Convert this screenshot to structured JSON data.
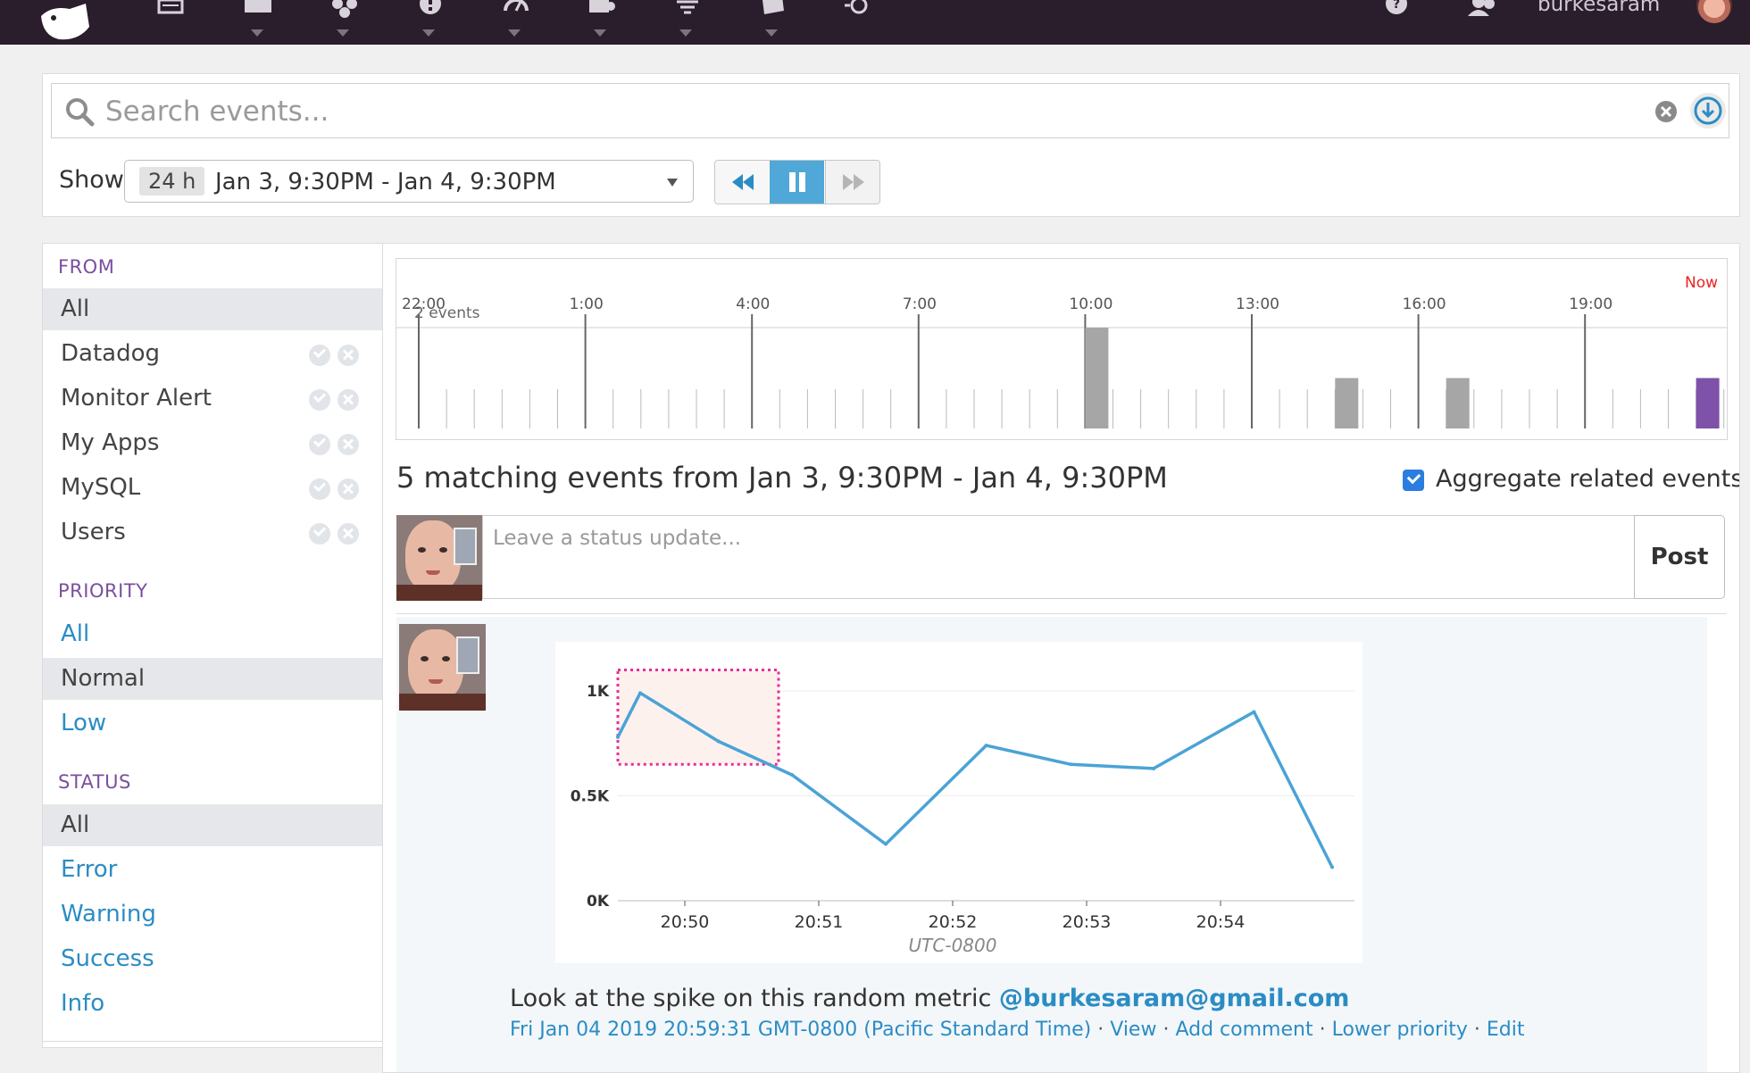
{
  "topnav": {
    "user_name": "burkesaram",
    "icons": [
      "dashboard-icon",
      "infrastructure-icon",
      "integrations-icon",
      "monitors-icon",
      "metrics-icon",
      "apm-icon",
      "notebooks-icon",
      "logs-icon",
      "watchdog-icon"
    ]
  },
  "search": {
    "placeholder": "Search events...",
    "show_label": "Show",
    "range_badge": "24 h",
    "range_text": "Jan 3, 9:30PM - Jan 4, 9:30PM"
  },
  "sidebar": {
    "from": {
      "header": "FROM",
      "items": [
        {
          "label": "All",
          "selected": true
        },
        {
          "label": "Datadog"
        },
        {
          "label": "Monitor Alert"
        },
        {
          "label": "My Apps"
        },
        {
          "label": "MySQL"
        },
        {
          "label": "Users"
        }
      ]
    },
    "priority": {
      "header": "PRIORITY",
      "items": [
        {
          "label": "All"
        },
        {
          "label": "Normal",
          "selected": true
        },
        {
          "label": "Low"
        }
      ]
    },
    "status": {
      "header": "STATUS",
      "items": [
        {
          "label": "All",
          "selected": true
        },
        {
          "label": "Error"
        },
        {
          "label": "Warning"
        },
        {
          "label": "Success"
        },
        {
          "label": "Info"
        }
      ]
    }
  },
  "timeline": {
    "now_label": "Now",
    "event_count_label": "2 events",
    "ticks": [
      "22:00",
      "1:00",
      "4:00",
      "7:00",
      "10:00",
      "13:00",
      "16:00",
      "19:00"
    ],
    "bars": [
      {
        "slot": 24,
        "level": 1.0,
        "color": "#a6a6a6"
      },
      {
        "slot": 33,
        "level": 0.5,
        "color": "#a6a6a6"
      },
      {
        "slot": 37,
        "level": 0.5,
        "color": "#a6a6a6"
      },
      {
        "slot": 46,
        "level": 0.5,
        "color": "#7d52a8"
      }
    ]
  },
  "events": {
    "heading": "5 matching events from Jan 3, 9:30PM - Jan 4, 9:30PM",
    "aggregate_label": "Aggregate related events",
    "aggregate_checked": true,
    "status_placeholder": "Leave a status update...",
    "post_label": "Post",
    "item": {
      "text": "Look at the spike on this random metric ",
      "mention": "@burkesaram@gmail.com",
      "timestamp": "Fri Jan 04 2019 20:59:31 GMT-0800 (Pacific Standard Time)",
      "actions": [
        "View",
        "Add comment",
        "Lower priority",
        "Edit"
      ]
    }
  },
  "chart_data": {
    "type": "line",
    "x": [
      "20:49:30",
      "20:49:40",
      "20:50:15",
      "20:50:48",
      "20:51:30",
      "20:52:15",
      "20:52:53",
      "20:53:30",
      "20:54:15",
      "20:54:50"
    ],
    "series": [
      {
        "values": [
          780,
          990,
          760,
          600,
          270,
          740,
          650,
          630,
          900,
          160
        ]
      }
    ],
    "x_ticks": [
      "20:50",
      "20:51",
      "20:52",
      "20:53",
      "20:54"
    ],
    "y_ticks": [
      "0K",
      "0.5K",
      "1K"
    ],
    "ylim": [
      0,
      1000
    ],
    "xlabel": "UTC-0800",
    "highlight": {
      "x_start": "20:49:30",
      "x_end": "20:50:42",
      "y_start": 650,
      "y_end": 1100
    },
    "colors": {
      "line": "#4aa3d6",
      "highlight_border": "#e62e99",
      "highlight_fill": "#fdf1ee"
    }
  }
}
